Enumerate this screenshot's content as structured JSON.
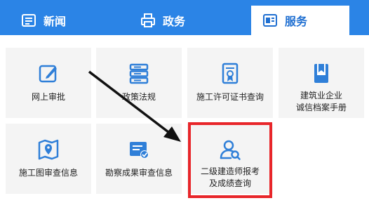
{
  "tabs": [
    {
      "label": "新闻",
      "icon": "news-list-icon",
      "active": false
    },
    {
      "label": "政务",
      "icon": "printer-icon",
      "active": false
    },
    {
      "label": "服务",
      "icon": "service-window-icon",
      "active": true
    }
  ],
  "tiles": [
    {
      "label": "网上审批",
      "icon": "edit-approval-icon"
    },
    {
      "label": "政策法规",
      "icon": "server-stack-icon"
    },
    {
      "label": "施工许可证书查询",
      "icon": "certificate-icon"
    },
    {
      "label_line1": "建筑业企业",
      "label_line2": "诚信档案手册",
      "icon": "archive-book-icon"
    },
    {
      "label": "施工图审查信息",
      "icon": "map-pin-icon"
    },
    {
      "label": "勘察成果审查信息",
      "icon": "checked-tray-icon"
    },
    {
      "label_line1": "二级建造师报考",
      "label_line2": "及成绩查询",
      "icon": "user-search-icon"
    }
  ],
  "colors": {
    "tab_bar": "#2b84e6",
    "icon_blue": "#2f7fd8",
    "highlight_red": "#e8262a",
    "tile_bg": "#f4f4f4"
  }
}
